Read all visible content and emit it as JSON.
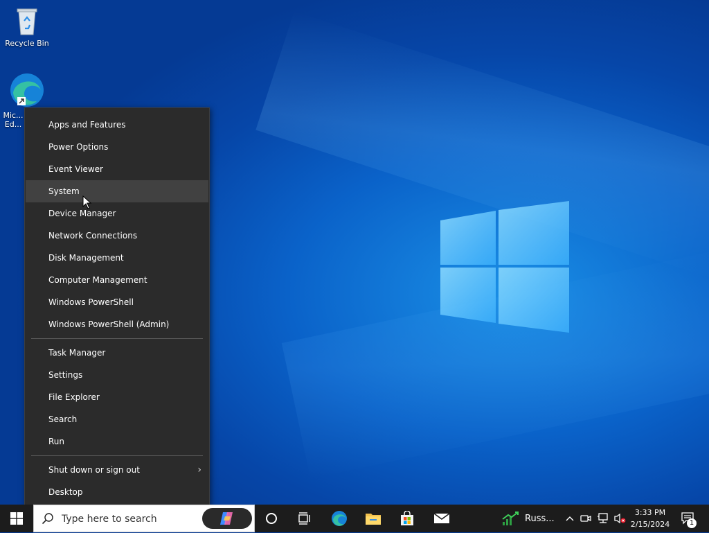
{
  "desktop": {
    "icons": [
      {
        "label": "Recycle Bin"
      },
      {
        "label": "Mic... Ed..."
      }
    ]
  },
  "context_menu": {
    "items_group1": [
      "Apps and Features",
      "Power Options",
      "Event Viewer",
      "System",
      "Device Manager",
      "Network Connections",
      "Disk Management",
      "Computer Management",
      "Windows PowerShell",
      "Windows PowerShell (Admin)"
    ],
    "items_group2": [
      "Task Manager",
      "Settings",
      "File Explorer",
      "Search",
      "Run"
    ],
    "items_group3": [
      "Shut down or sign out",
      "Desktop"
    ],
    "hovered": "System"
  },
  "taskbar": {
    "search_placeholder": "Type here to search",
    "stock_label": "Russ...",
    "time": "3:33 PM",
    "date": "2/15/2024",
    "notification_count": "1"
  },
  "colors": {
    "menu_bg": "#2b2b2b",
    "menu_hover": "#414141",
    "taskbar_bg": "#1c1c1c",
    "desktop_accent": "#0a62c9"
  }
}
